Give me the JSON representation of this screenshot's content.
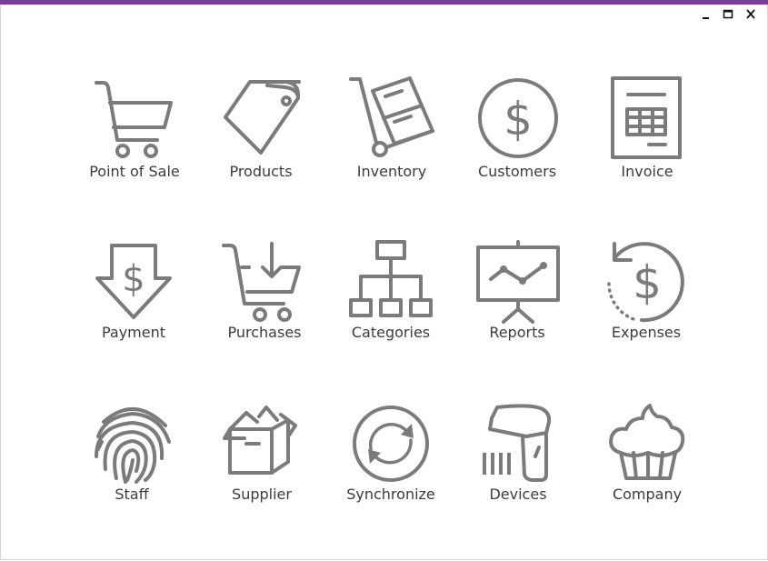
{
  "window": {
    "accent_color": "#7a3e96",
    "controls": {
      "minimize": "minimize-icon",
      "maximize": "maximize-icon",
      "close": "close-icon"
    }
  },
  "icon_color": "#7b7b7b",
  "tiles": [
    {
      "label": "Point of Sale",
      "icon": "shopping-cart-icon"
    },
    {
      "label": "Products",
      "icon": "price-tags-icon"
    },
    {
      "label": "Inventory",
      "icon": "hand-truck-icon"
    },
    {
      "label": "Customers",
      "icon": "dollar-circle-icon"
    },
    {
      "label": "Invoice",
      "icon": "invoice-document-icon"
    },
    {
      "label": "Payment",
      "icon": "dollar-down-arrow-icon"
    },
    {
      "label": "Purchases",
      "icon": "cart-arrow-down-icon"
    },
    {
      "label": "Categories",
      "icon": "hierarchy-icon"
    },
    {
      "label": "Reports",
      "icon": "presentation-chart-icon"
    },
    {
      "label": "Expenses",
      "icon": "dollar-refresh-icon"
    },
    {
      "label": "Staff",
      "icon": "fingerprint-icon"
    },
    {
      "label": "Supplier",
      "icon": "open-box-icon"
    },
    {
      "label": "Synchronize",
      "icon": "sync-icon"
    },
    {
      "label": "Devices",
      "icon": "barcode-scanner-icon"
    },
    {
      "label": "Company",
      "icon": "cupcake-icon"
    }
  ]
}
